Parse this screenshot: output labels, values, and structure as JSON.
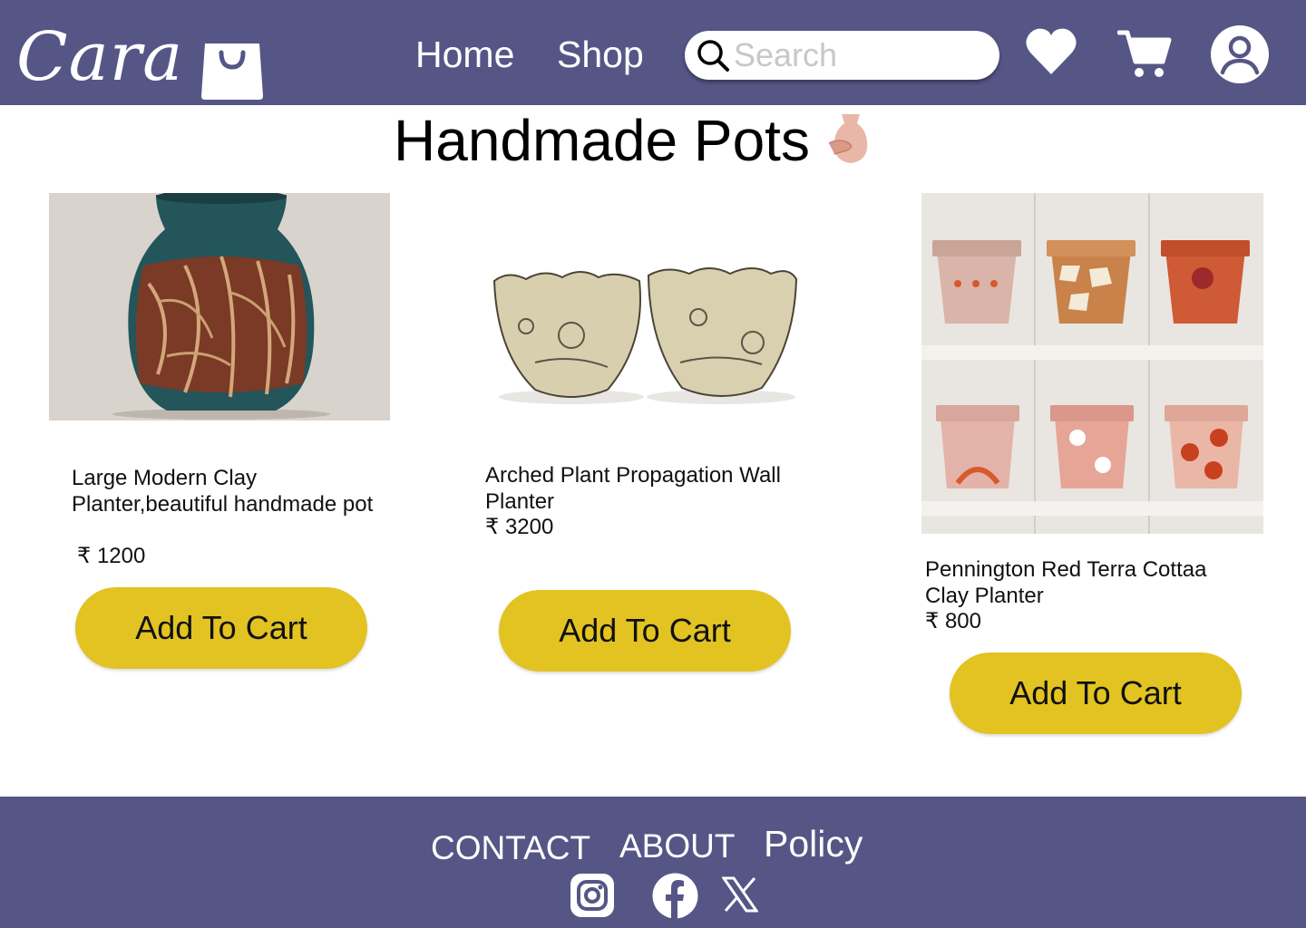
{
  "brand": {
    "name": "Cara"
  },
  "nav": {
    "home": "Home",
    "shop": "Shop"
  },
  "search": {
    "placeholder": "Search"
  },
  "page": {
    "title": "Handmade Pots"
  },
  "products": [
    {
      "name": "Large Modern Clay Planter,beautiful handmade pot",
      "price": "₹ 1200",
      "button": "Add To Cart"
    },
    {
      "name": "Arched Plant Propagation Wall Planter",
      "price": "₹ 3200",
      "button": "Add To Cart"
    },
    {
      "name": "Pennington Red Terra Cottaa Clay Planter",
      "price": "₹ 800",
      "button": "Add To Cart"
    }
  ],
  "footer": {
    "contact": "CONTACT",
    "about": "ABOUT",
    "policy": "Policy"
  },
  "icons": {
    "header": [
      "heart-icon",
      "cart-icon",
      "user-icon",
      "search-icon"
    ],
    "social": [
      "instagram-icon",
      "facebook-icon",
      "x-icon"
    ]
  },
  "colors": {
    "header_bg": "#555686",
    "button": "#e2c322",
    "footer_bg": "#555686"
  }
}
